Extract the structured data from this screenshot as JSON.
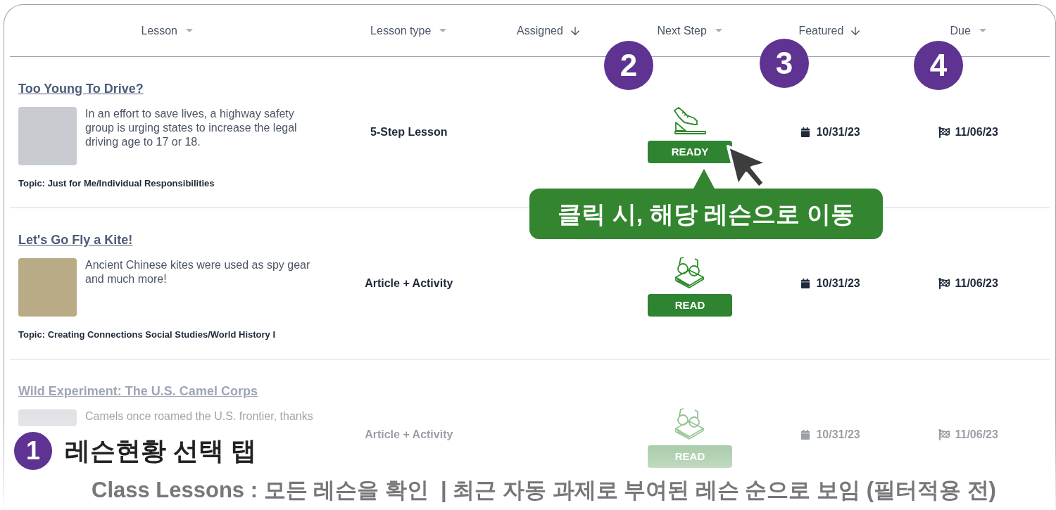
{
  "table": {
    "columns": [
      {
        "label": "Lesson",
        "kind": "menu"
      },
      {
        "label": "Lesson type",
        "kind": "menu"
      },
      {
        "label": "Assigned",
        "kind": "descending"
      },
      {
        "label": "Next Step",
        "kind": "menu"
      },
      {
        "label": "Featured",
        "kind": "descending"
      },
      {
        "label": "Due",
        "kind": "menu"
      }
    ],
    "rows": [
      {
        "title": "Too Young To Drive?",
        "description": "In an effort to save lives, a highway safety group is urging states to increase the legal driving age to 17 or 18.",
        "topic": "Topic: Just for Me/Individual Responsibilities",
        "lesson_type": "5-Step Lesson",
        "next_step": {
          "kind": "shoe",
          "label": "READY"
        },
        "featured": "10/31/23",
        "due": "11/06/23",
        "faded": false
      },
      {
        "title": "Let's Go Fly a Kite!",
        "description": "Ancient Chinese kites were used as spy gear and much more!",
        "topic": "Topic: Creating Connections Social Studies/World History I",
        "lesson_type": "Article + Activity",
        "next_step": {
          "kind": "book",
          "label": "READ"
        },
        "featured": "10/31/23",
        "due": "11/06/23",
        "faded": false
      },
      {
        "title": "Wild Experiment: The U.S. Camel Corps",
        "description": "Camels once roamed the U.S. frontier, thanks",
        "lesson_type": "Article + Activity",
        "next_step": {
          "kind": "book",
          "label": "READ"
        },
        "featured": "10/31/23",
        "due": "11/06/23",
        "faded": true
      }
    ]
  },
  "annotations": {
    "markers": [
      {
        "number": "2"
      },
      {
        "number": "3"
      },
      {
        "number": "4"
      }
    ],
    "tooltip": "클릭 시, 해당 레슨으로 이동",
    "callout": {
      "number": "1",
      "title": "레슨현황 선택 탭",
      "caption": "Class Lessons : 모든 레슨을 확인  | 최근 자동 과제로 부여된 레슨 순으로 보임 (필터적용 전)"
    }
  }
}
